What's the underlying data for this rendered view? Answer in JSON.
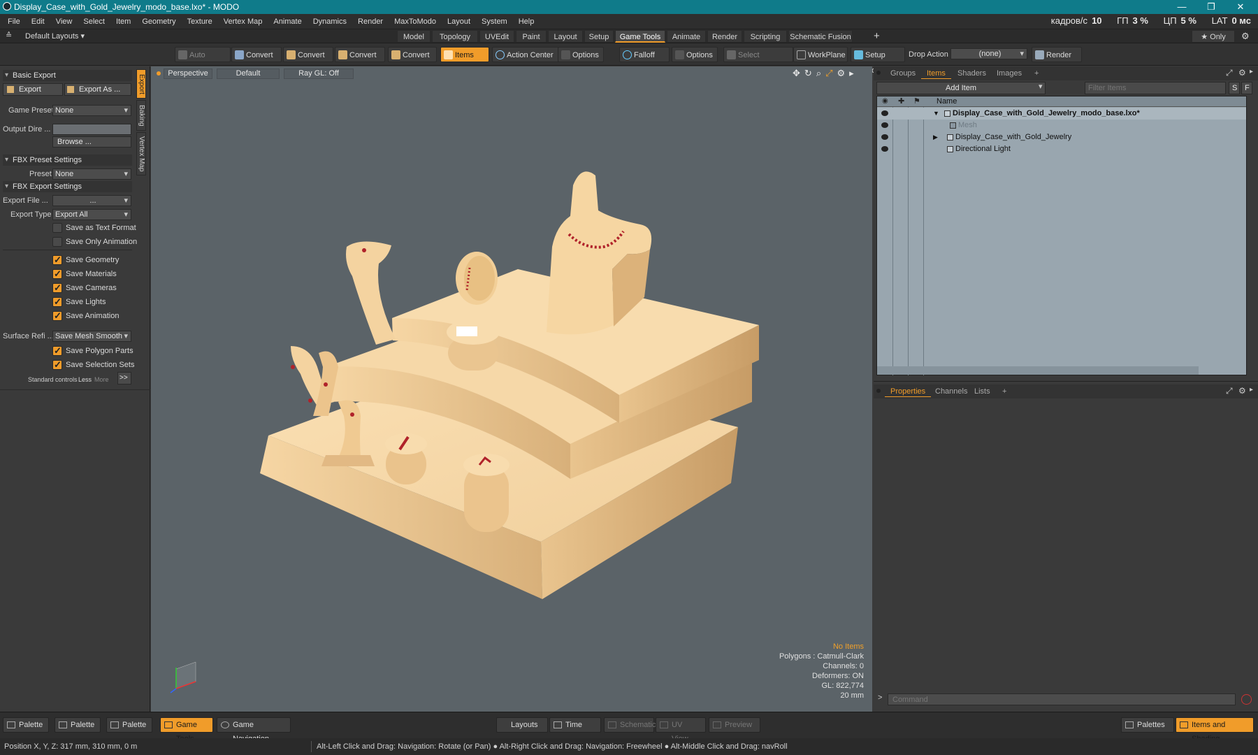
{
  "window": {
    "title": "Display_Case_with_Gold_Jewelry_modo_base.lxo* - MODO",
    "minimize": "—",
    "maximize": "❐",
    "close": "✕"
  },
  "menu": [
    "File",
    "Edit",
    "View",
    "Select",
    "Item",
    "Geometry",
    "Texture",
    "Vertex Map",
    "Animate",
    "Dynamics",
    "Render",
    "MaxToModo",
    "Layout",
    "System",
    "Help"
  ],
  "stats": {
    "fps_label": "кадров/с",
    "fps": "10",
    "gpu_label": "ГП",
    "gpu": "3 %",
    "cpu_label": "ЦП",
    "cpu": "5 %",
    "lat_label": "LAT",
    "lat": "0 мс"
  },
  "layouts": {
    "default_layouts": "Default Layouts ▾",
    "tabs": [
      "Model",
      "Topology",
      "UVEdit",
      "Paint",
      "Layout",
      "Setup",
      "Game Tools",
      "Animate",
      "Render",
      "Scripting",
      "Schematic Fusion"
    ],
    "active_tab": "Game Tools",
    "add": "+",
    "only": "★  Only",
    "gear": "⚙"
  },
  "toolbar": {
    "auto_select": "Auto Select",
    "convert": "Convert",
    "items": "Items",
    "action_center": "Action Center",
    "options": "Options",
    "falloff": "Falloff",
    "select_through": "Select Through",
    "workplane": "WorkPlane",
    "setup_mode": "Setup Mode",
    "drop_action": "Drop Action",
    "drop_value": "(none)",
    "render": "Render ..."
  },
  "left": {
    "basic_export": "Basic Export",
    "export_btn": "Export",
    "export_as_btn": "Export As ...",
    "game_preset_label": "Game Preset",
    "game_preset_value": "None",
    "output_dir_label": "Output Dire ...",
    "browse": "Browse ...",
    "fbx_preset_settings": "FBX Preset Settings",
    "preset_label": "Preset",
    "preset_value": "None",
    "fbx_export_settings": "FBX Export Settings",
    "export_file_label": "Export File   ...",
    "export_file_value": "...",
    "export_type_label": "Export Type",
    "export_type_value": "Export All",
    "checkboxes": [
      {
        "label": "Save as Text Format",
        "checked": false
      },
      {
        "label": "Save Only Animation",
        "checked": false
      },
      {
        "label": "Save Geometry",
        "checked": true
      },
      {
        "label": "Save Materials",
        "checked": true
      },
      {
        "label": "Save Cameras",
        "checked": true
      },
      {
        "label": "Save Lights",
        "checked": true
      },
      {
        "label": "Save Animation",
        "checked": true
      }
    ],
    "surface_label": "Surface Refi ...",
    "surface_value": "Save Mesh Smooth ...",
    "checkboxes2": [
      {
        "label": "Save Polygon Parts",
        "checked": true
      },
      {
        "label": "Save Selection Sets",
        "checked": true
      }
    ],
    "standard_controls": "Standard controls",
    "less": "Less",
    "more": "More",
    "more_btn": ">>",
    "vtabs": [
      "Export",
      "Baking",
      "Vertex Map"
    ]
  },
  "viewport": {
    "view": "Perspective",
    "shading": "Default",
    "raygl": "Ray GL: Off",
    "overlay": {
      "no_items": "No Items",
      "polygons": "Polygons : Catmull-Clark",
      "channels": "Channels: 0",
      "deformers": "Deformers: ON",
      "gl": "GL: 822,774",
      "scale": "20 mm"
    }
  },
  "right": {
    "tabs": [
      "Groups",
      "Items",
      "Shaders",
      "Images"
    ],
    "active_tab": "Items",
    "add": "+",
    "add_item": "Add Item",
    "filter_placeholder": "Filter Items",
    "s": "S",
    "f": "F",
    "name_col": "Name",
    "items": [
      {
        "label": "Display_Case_with_Gold_Jewelry_modo_base.lxo*",
        "indent": 0,
        "bold": true,
        "arrow": "▼",
        "dim": false
      },
      {
        "label": "Mesh",
        "indent": 2,
        "bold": false,
        "arrow": "",
        "dim": true
      },
      {
        "label": "Display_Case_with_Gold_Jewelry",
        "indent": 1,
        "bold": false,
        "arrow": "▶",
        "dim": false
      },
      {
        "label": "Directional Light",
        "indent": 1,
        "bold": false,
        "arrow": "",
        "dim": false
      }
    ],
    "props_tabs": [
      "Properties",
      "Channels",
      "Lists"
    ],
    "props_active": "Properties",
    "command_placeholder": "Command"
  },
  "bottom": {
    "palette": "Palette",
    "game_tools": "Game Tools",
    "game_navigation": "Game Navigation",
    "layouts": "Layouts",
    "time": "Time",
    "schematic": "Schematic",
    "uv_view": "UV View",
    "preview": "Preview",
    "palettes": "Palettes",
    "items_shading": "Items and Shading"
  },
  "status": {
    "position": "Position X, Y, Z:   317 mm, 310 mm, 0 m",
    "hint": "Alt-Left Click and Drag: Navigation: Rotate (or Pan) ● Alt-Right Click and Drag: Navigation: Freewheel ● Alt-Middle Click and Drag: navRoll"
  },
  "colors": {
    "accent": "#f09c2a",
    "titlebar": "#0f7b8a",
    "gold": "#f2d1a0",
    "jewel": "#b0222a",
    "viewport": "#5b6368"
  }
}
